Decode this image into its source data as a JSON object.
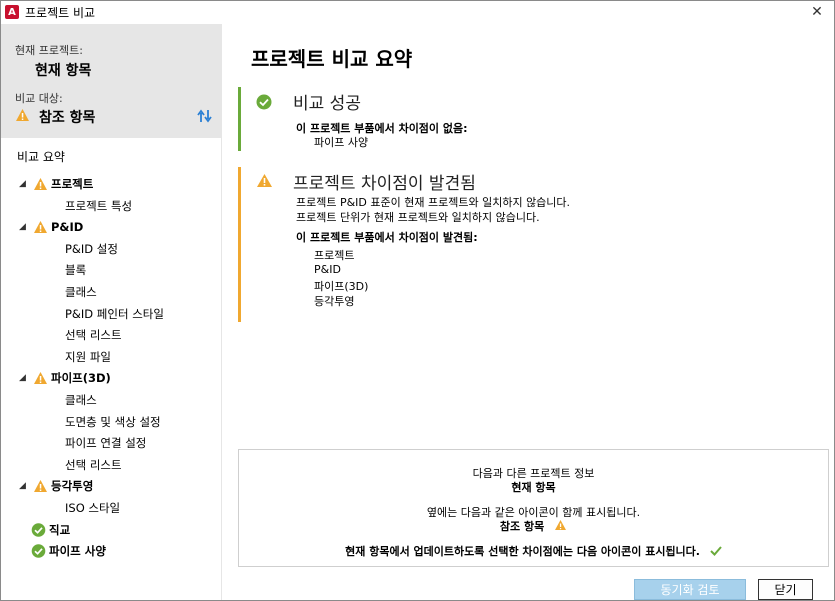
{
  "window": {
    "title": "프로젝트 비교",
    "app_icon_letter": "A",
    "close_glyph": "✕"
  },
  "left": {
    "current_project_label": "현재 프로젝트:",
    "current_project_value": "현재 항목",
    "compare_label": "비교 대상:",
    "compare_value": "참조 항목",
    "summary_heading": "비교 요약",
    "tree": [
      {
        "label": "프로젝트",
        "status": "warning",
        "level": 0,
        "expanded": true
      },
      {
        "label": "프로젝트 특성",
        "level": 1
      },
      {
        "label": "P&ID",
        "status": "warning",
        "level": 0,
        "expanded": true
      },
      {
        "label": "P&ID 설정",
        "level": 1
      },
      {
        "label": "블록",
        "level": 1
      },
      {
        "label": "클래스",
        "level": 1
      },
      {
        "label": "P&ID 페인터 스타일",
        "level": 1
      },
      {
        "label": "선택 리스트",
        "level": 1
      },
      {
        "label": "지원 파일",
        "level": 1
      },
      {
        "label": "파이프(3D)",
        "status": "warning",
        "level": 0,
        "expanded": true
      },
      {
        "label": "클래스",
        "level": 1
      },
      {
        "label": "도면층 및 색상 설정",
        "level": 1
      },
      {
        "label": "파이프 연결 설정",
        "level": 1
      },
      {
        "label": "선택 리스트",
        "level": 1
      },
      {
        "label": "등각투영",
        "status": "warning",
        "level": 0,
        "expanded": true
      },
      {
        "label": "ISO 스타일",
        "level": 1
      },
      {
        "label": "직교",
        "status": "ok",
        "level": 0
      },
      {
        "label": "파이프 사양",
        "status": "ok",
        "level": 0
      }
    ]
  },
  "main": {
    "title": "프로젝트 비교 요약",
    "success": {
      "heading": "비교 성공",
      "subheading": "이 프로젝트 부품에서 차이점이 없음:",
      "items": [
        "파이프 사양"
      ]
    },
    "differences": {
      "heading": "프로젝트 차이점이 발견됨",
      "notes": [
        "프로젝트 P&ID 표준이 현재 프로젝트와 일치하지 않습니다.",
        "프로젝트 단위가 현재 프로젝트와 일치하지 않습니다."
      ],
      "subheading": "이 프로젝트 부품에서 차이점이 발견됨:",
      "items": [
        "프로젝트",
        "P&ID",
        "파이프(3D)",
        "등각투영"
      ]
    },
    "info": {
      "line1": "다음과 다른 프로젝트 정보",
      "line2": "현재 항목",
      "line3": "옆에는 다음과 같은 아이콘이 함께 표시됩니다.",
      "line4": "참조 항목",
      "line5": "현재 항목에서 업데이트하도록 선택한 차이점에는 다음 아이콘이 표시됩니다."
    }
  },
  "buttons": {
    "sync_review": "동기화 검토",
    "close": "닫기"
  },
  "colors": {
    "warning": "#f0a830",
    "ok": "#6aaa3a",
    "sync_button": "#a7d1ec",
    "left_header_bg": "#e6e6e6"
  }
}
